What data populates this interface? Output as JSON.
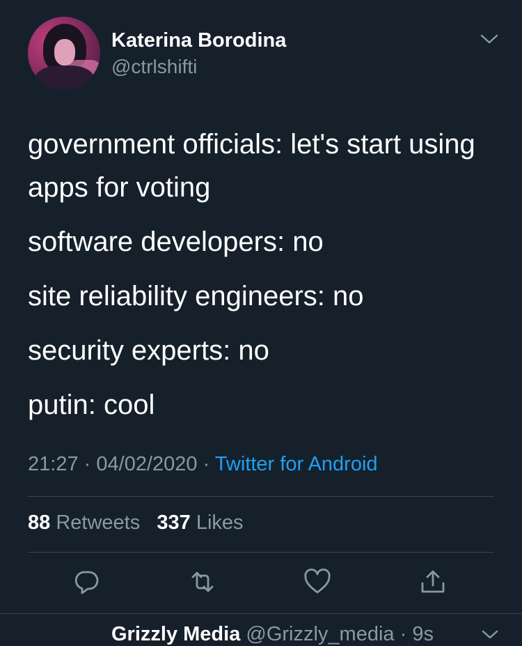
{
  "tweet": {
    "author_name": "Katerina Borodina",
    "author_handle": "@ctrlshifti",
    "lines": [
      "government officials: let's start using apps for voting",
      "software developers: no",
      "site reliability engineers: no",
      "security experts: no",
      "putin: cool"
    ],
    "time": "21:27",
    "date": "04/02/2020",
    "separator": "·",
    "source": "Twitter for Android",
    "retweet_count": "88",
    "retweet_label": "Retweets",
    "like_count": "337",
    "like_label": "Likes",
    "actions": [
      "reply-icon",
      "retweet-icon",
      "like-icon",
      "share-icon"
    ]
  },
  "next_tweet": {
    "author_name": "Grizzly Media",
    "author_handle_time": "@Grizzly_media · 9s"
  },
  "colors": {
    "background": "#15202b",
    "secondary_text": "#8899a6",
    "link": "#1da1f2",
    "divider": "#38444d"
  }
}
